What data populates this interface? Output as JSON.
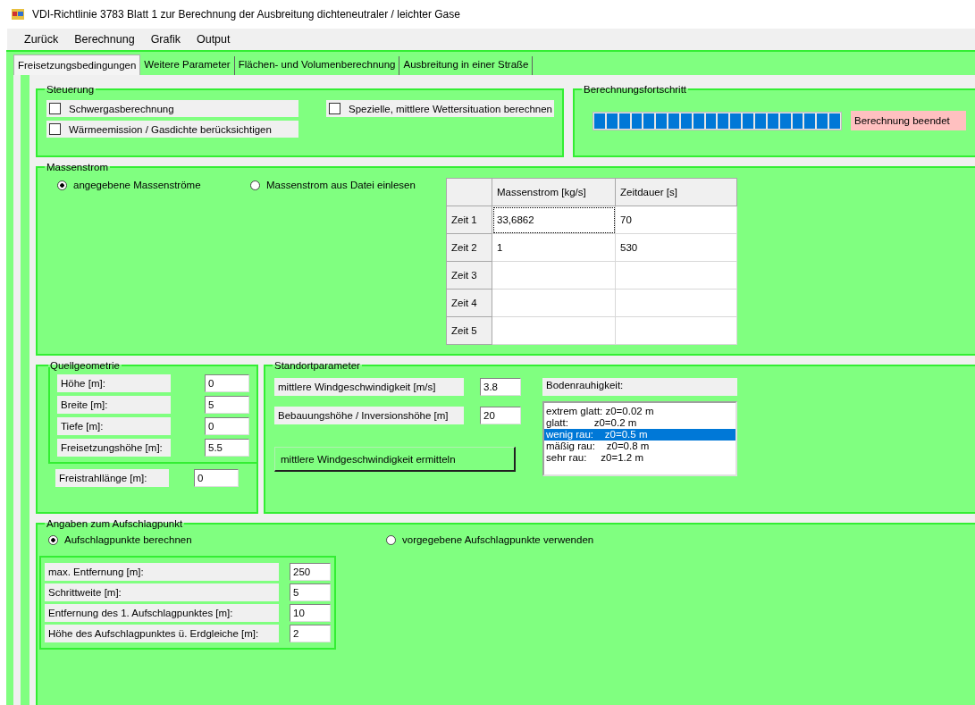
{
  "window": {
    "title": "VDI-Richtlinie 3783 Blatt 1 zur Berechnung der Ausbreitung dichteneutraler / leichter Gase"
  },
  "menu": [
    "Zurück",
    "Berechnung",
    "Grafik",
    "Output"
  ],
  "tabs": [
    {
      "label": "Freisetzungsbedingungen",
      "selected": true
    },
    {
      "label": "Weitere Parameter",
      "selected": false
    },
    {
      "label": "Flächen- und Volumenberechnung",
      "selected": false
    },
    {
      "label": "Ausbreitung in einer Straße",
      "selected": false
    }
  ],
  "steuerung": {
    "title": "Steuerung",
    "checkboxes": [
      {
        "label": "Schwergasberechnung",
        "checked": false
      },
      {
        "label": "Wärmeemission / Gasdichte berücksichtigen",
        "checked": false
      },
      {
        "label": "Spezielle, mittlere Wettersituation berechnen",
        "checked": false
      }
    ]
  },
  "progress": {
    "title": "Berechnungsfortschritt",
    "level": 1,
    "status": "Berechnung beendet"
  },
  "massenstrom": {
    "title": "Massenstrom",
    "options": [
      {
        "label": "angegebene Massenströme",
        "selected": true
      },
      {
        "label": "Massenstrom aus Datei einlesen",
        "selected": false
      }
    ],
    "table": {
      "columns": [
        "Massenstrom [kg/s]",
        "Zeitdauer [s]"
      ],
      "rows": [
        {
          "header": "Zeit 1",
          "cells": [
            "33,6862",
            "70"
          ],
          "focused": true
        },
        {
          "header": "Zeit 2",
          "cells": [
            "1",
            "530"
          ],
          "focused": false
        },
        {
          "header": "Zeit 3",
          "focused": false
        },
        {
          "header": "Zeit 4",
          "focused": false
        },
        {
          "header": "Zeit 5",
          "focused": false
        }
      ]
    }
  },
  "quellgeometrie": {
    "title": "Quellgeometrie",
    "fields": [
      {
        "label": "Höhe [m]:",
        "value": "0"
      },
      {
        "label": "Breite [m]:",
        "value": "5"
      },
      {
        "label": "Tiefe [m]:",
        "value": "0"
      },
      {
        "label": "Freisetzungshöhe [m]:",
        "value": "5.5"
      }
    ],
    "freistrahl": {
      "label": "Freistrahllänge [m]:",
      "value": "0"
    }
  },
  "standort": {
    "title": "Standortparameter",
    "fields": [
      {
        "label": "mittlere Windgeschwindigkeit [m/s]",
        "value": "3.8"
      },
      {
        "label": "Bebauungshöhe / Inversionshöhe [m]",
        "value": "20"
      }
    ],
    "button": "mittlere Windgeschwindigkeit ermitteln",
    "roughness": {
      "label": "Bodenrauhigkeit:",
      "items": [
        {
          "label": "extrem glatt: z0=0.02 m",
          "selected": false
        },
        {
          "label": "glatt:         z0=0.2 m",
          "selected": false
        },
        {
          "label": "wenig rau:    z0=0.5 m",
          "selected": true
        },
        {
          "label": "mäßig rau:    z0=0.8 m",
          "selected": false
        },
        {
          "label": "sehr rau:     z0=1.2 m",
          "selected": false
        }
      ]
    }
  },
  "aufschlag": {
    "title": "Angaben zum Aufschlagpunkt",
    "options": [
      {
        "label": "Aufschlagpunkte berechnen",
        "selected": true
      },
      {
        "label": "vorgegebene Aufschlagpunkte verwenden",
        "selected": false
      }
    ],
    "fields": [
      {
        "label": "max. Entfernung [m]:",
        "value": "250"
      },
      {
        "label": "Schrittweite [m]:",
        "value": "5"
      },
      {
        "label": "Entfernung des 1. Aufschlagpunktes [m]:",
        "value": "10"
      },
      {
        "label": "Höhe des Aufschlagpunktes ü. Erdgleiche [m]:",
        "value": "2"
      }
    ]
  }
}
